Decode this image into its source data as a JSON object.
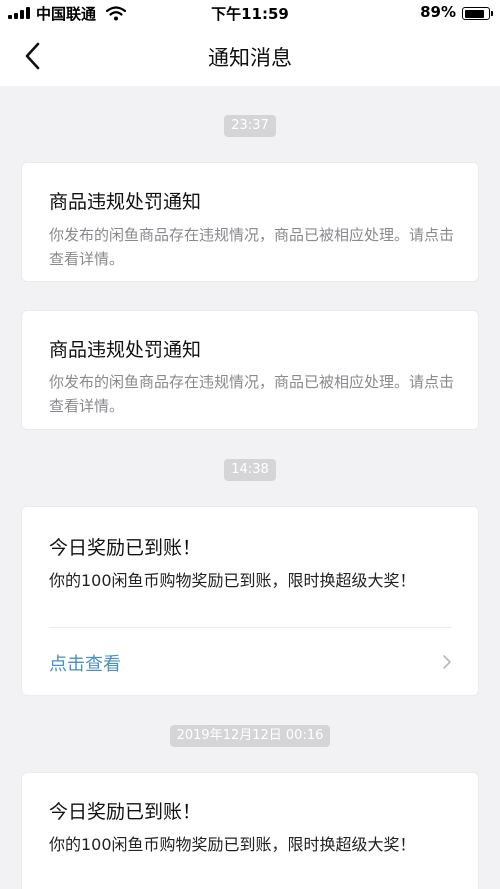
{
  "status_bar": {
    "carrier": "中国联通",
    "time": "下午11:59",
    "battery": "89%",
    "battery_level": 0.89
  },
  "nav": {
    "title": "通知消息"
  },
  "timestamps": [
    "23:37",
    "14:38",
    "2019年12月12日  00:16"
  ],
  "cards": [
    {
      "title": "商品违规处罚通知",
      "body": "你发布的闲鱼商品存在违规情况，商品已被相应处理。请点击查看详情。"
    },
    {
      "title": "商品违规处罚通知",
      "body": "你发布的闲鱼商品存在违规情况，商品已被相应处理。请点击查看详情。"
    },
    {
      "title": "今日奖励已到账！",
      "body": "你的100闲鱼币购物奖励已到账，限时换超级大奖！",
      "link": "点击查看"
    },
    {
      "title": "今日奖励已到账！",
      "body": "你的100闲鱼币购物奖励已到账，限时换超级大奖！"
    }
  ],
  "colors": {
    "background": "#f2f2f4",
    "card": "#ffffff",
    "link": "#4a90c4",
    "timestamp_bg": "#d5d5d8"
  },
  "icons": [
    "signal-icon",
    "wifi-icon",
    "battery-icon",
    "back-arrow-icon",
    "chevron-right-icon"
  ]
}
